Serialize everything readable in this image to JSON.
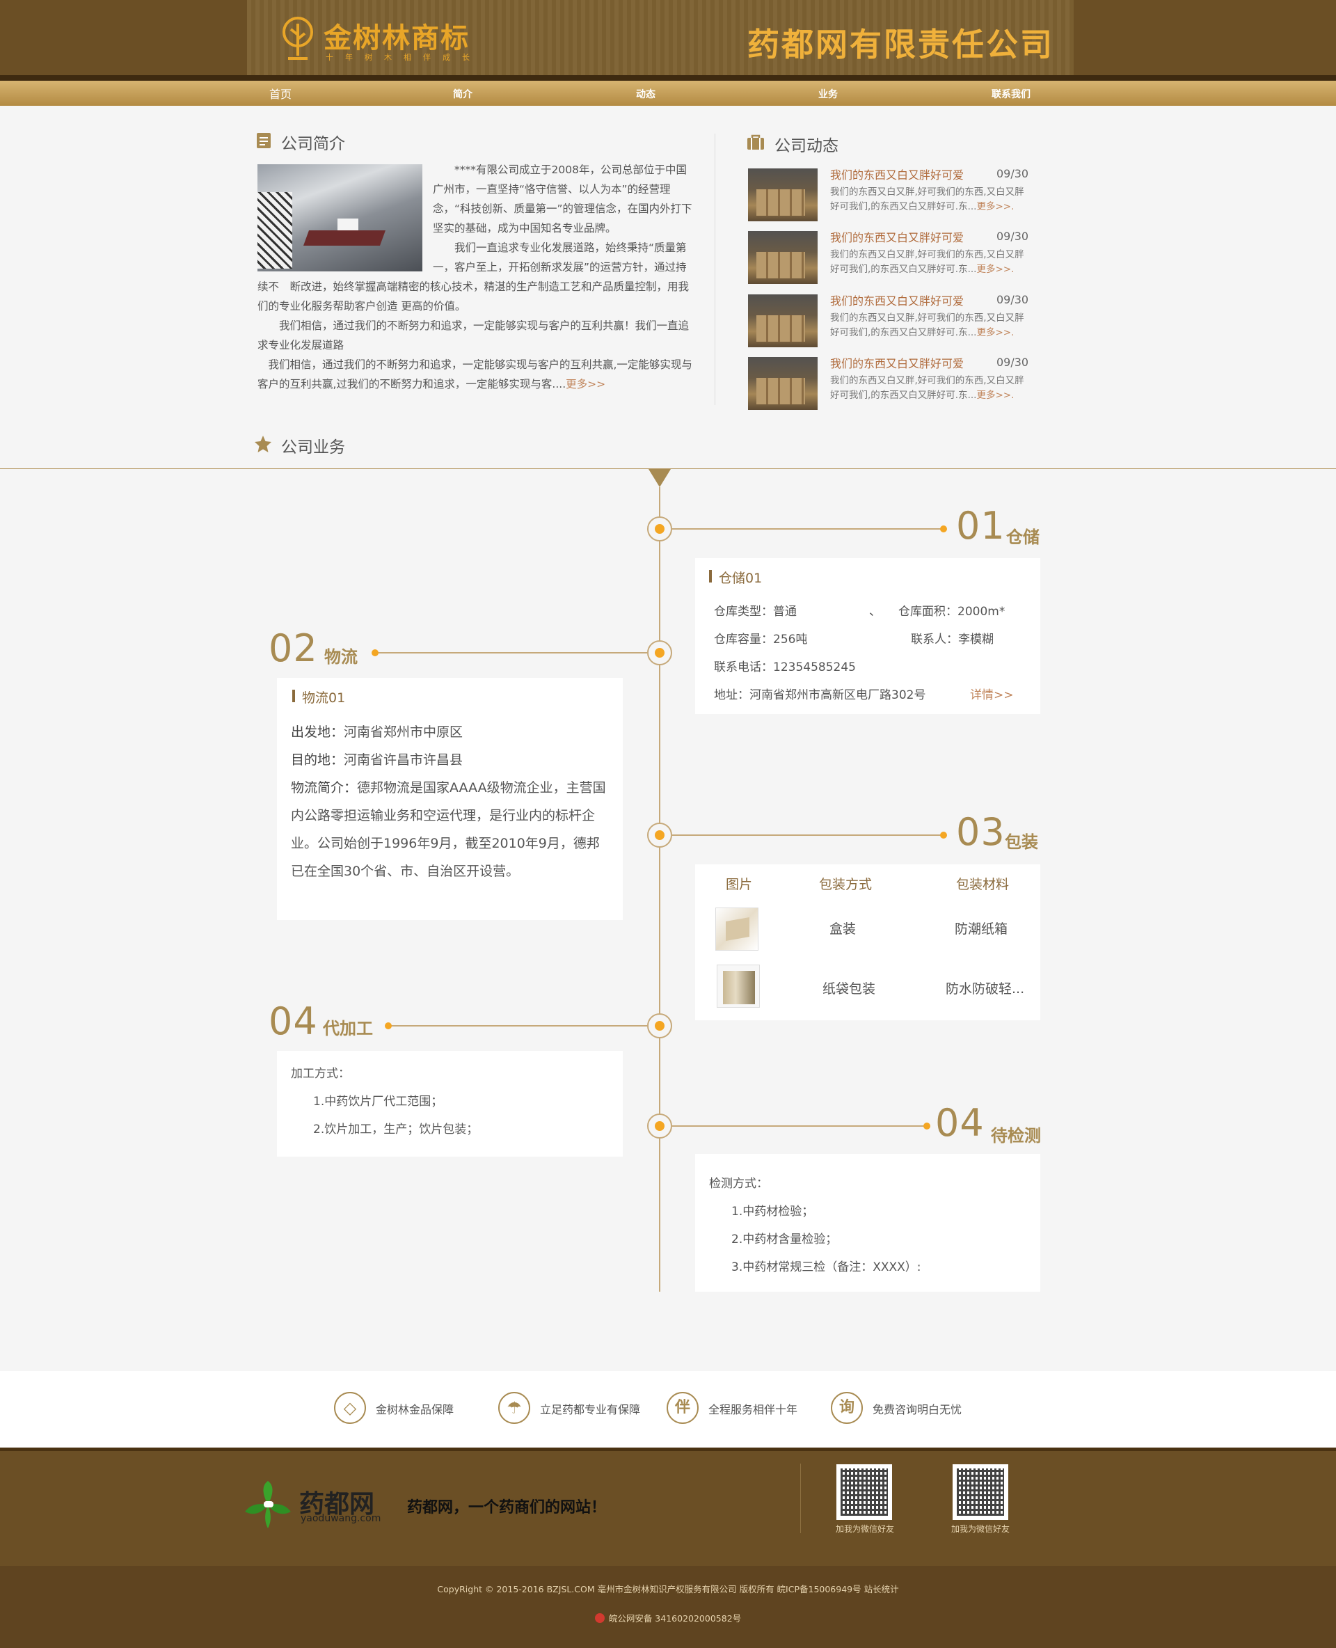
{
  "header": {
    "logo_text": "金树林商标",
    "logo_sub": "十年树木相伴成长",
    "company_title": "药都网有限责任公司"
  },
  "nav": [
    "首页",
    "简介",
    "动态",
    "业务",
    "联系我们"
  ],
  "intro": {
    "title": "公司简介",
    "paragraphs": [
      "　　****有限公司成立于2008年，公司总部位于中国广州市，一直坚持“恪守信誉、以人为本”的经营理念，“科技创新、质量第一”的管理信念，在国内外打下坚实的基础，成为中国知名专业品牌。",
      "　　我们一直追求专业化发展道路，始终秉持“质量第一，客户至上，开拓创新求发展”的运营方针，通过持续不　断改进，始终掌握高端精密的核心技术，精湛的生产制造工艺和产品质量控制，用我们的专业化服务帮助客户创造 更高的价值。",
      "　　我们相信，通过我们的不断努力和追求，一定能够实现与客户的互利共赢！我们一直追求专业化发展道路",
      "　我们相信，通过我们的不断努力和追求，一定能够实现与客户的互利共赢,一定能够实现与客户的互利共赢,过我们的不断努力和追求，一定能够实现与客...."
    ],
    "more": "更多>>"
  },
  "news": {
    "title": "公司动态",
    "items": [
      {
        "title": "我们的东西又白又胖好可爱",
        "date": "09/30",
        "desc": "我们的东西又白又胖,好可我们的东西,又白又胖好可我们,的东西又白又胖好可.东...",
        "more": "更多>>."
      },
      {
        "title": "我们的东西又白又胖好可爱",
        "date": "09/30",
        "desc": "我们的东西又白又胖,好可我们的东西,又白又胖好可我们,的东西又白又胖好可.东...",
        "more": "更多>>."
      },
      {
        "title": "我们的东西又白又胖好可爱",
        "date": "09/30",
        "desc": "我们的东西又白又胖,好可我们的东西,又白又胖好可我们,的东西又白又胖好可.东...",
        "more": "更多>>."
      },
      {
        "title": "我们的东西又白又胖好可爱",
        "date": "09/30",
        "desc": "我们的东西又白又胖,好可我们的东西,又白又胖好可我们,的东西又白又胖好可.东...",
        "more": "更多>>."
      }
    ]
  },
  "business": {
    "title": "公司业务",
    "storage": {
      "num": "01",
      "label": "仓储",
      "card_title": "仓储01",
      "type": "仓库类型：普通",
      "sep": "、",
      "area": "仓库面积：2000m*",
      "capacity": "仓库容量：256吨",
      "contact": "联系人：李模糊",
      "phone": "联系电话：12354585245",
      "address": "地址：河南省郑州市高新区电厂路302号",
      "detail": "详情>>"
    },
    "logistics": {
      "num": "02",
      "label": "物流",
      "card_title": "物流01",
      "from_label": "出发地：",
      "from": "河南省郑州市中原区",
      "to_label": "目的地：",
      "to": "河南省许昌市许昌县",
      "intro_label": "物流简介：",
      "intro": "德邦物流是国家AAAA级物流企业，主营国内公路零担运输业务和空运代理，是行业内的标杆企业。公司始创于1996年9月，截至2010年9月，德邦已在全国30个省、市、自治区开设营。"
    },
    "packaging": {
      "num": "03",
      "label": "包装",
      "headers": [
        "图片",
        "包装方式",
        "包装材料"
      ],
      "rows": [
        {
          "method": "盒装",
          "material": "防潮纸箱"
        },
        {
          "method": "纸袋包装",
          "material": "防水防破轻..."
        }
      ]
    },
    "processing": {
      "num": "04",
      "label": "代加工",
      "method_label": "加工方式：",
      "items": [
        "1.中药饮片厂代工范围；",
        "2.饮片加工，生产；饮片包装；"
      ]
    },
    "testing": {
      "num": "04",
      "label": "待检测",
      "method_label": "检测方式：",
      "items": [
        "1.中药材检验；",
        "2.中药材含量检验；",
        "3.中药材常规三检（备注：XXXX）:"
      ]
    }
  },
  "guarantees": [
    {
      "icon": "diamond-icon",
      "glyph": "◇",
      "text": "金树林金品保障"
    },
    {
      "icon": "umbrella-icon",
      "glyph": "☂",
      "text": "立足药都专业有保障"
    },
    {
      "icon": "partner-icon",
      "glyph": "伴",
      "text": "全程服务相伴十年"
    },
    {
      "icon": "inquiry-icon",
      "glyph": "询",
      "text": "免费咨询明白无忧"
    }
  ],
  "footer": {
    "logo_text": "药都网",
    "logo_url": "yaoduwang.com",
    "slogan": "药都网，一个药商们的网站！",
    "qr_labels": [
      "加我为微信好友",
      "加我为微信好友"
    ],
    "copyright": "CopyRight © 2015-2016 BZJSL.COM 亳州市金树林知识产权服务有限公司  版权所有  皖ICP备15006949号  站长统计",
    "police": "皖公网安备 34160202000582号"
  },
  "colors": {
    "header_bg": "#6b4f25",
    "accent": "#a88b52",
    "dot": "#f4a623",
    "gold_text": "#f0b13b"
  }
}
